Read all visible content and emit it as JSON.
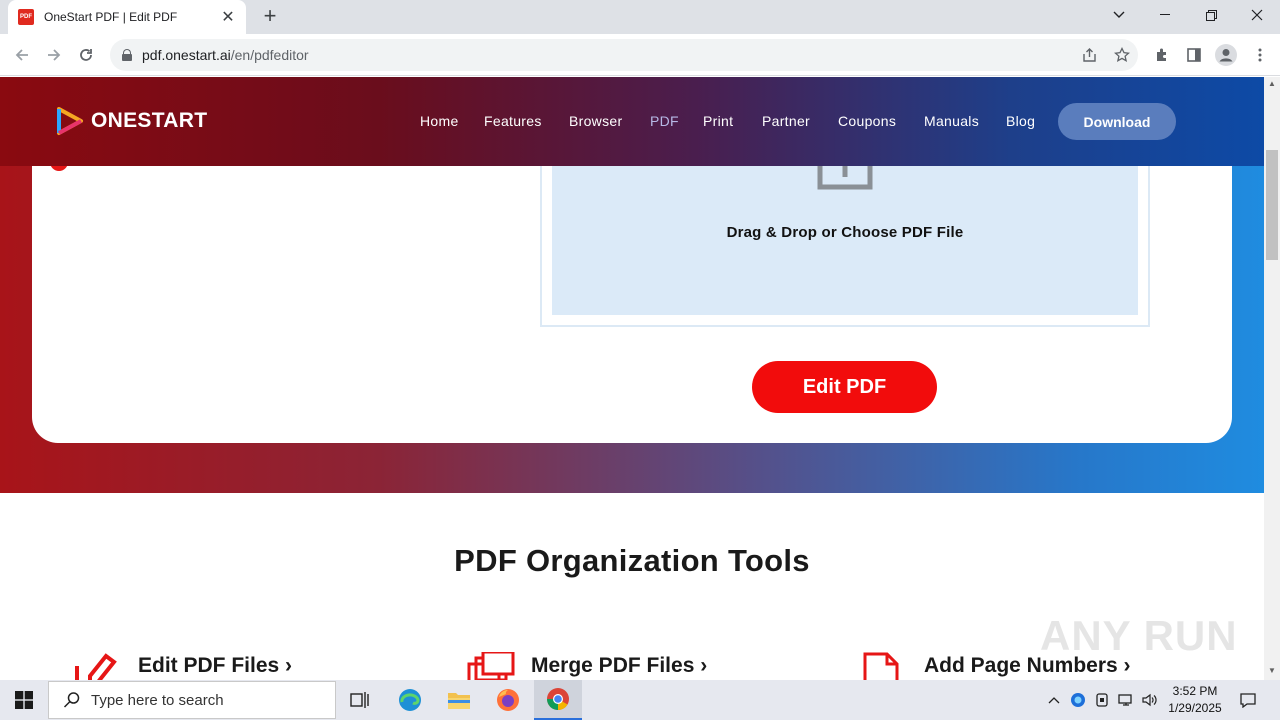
{
  "browser": {
    "tab_title": "OneStart PDF | Edit PDF",
    "favicon_text": "PDF",
    "url_host": "pdf.onestart.ai",
    "url_path": "/en/pdfeditor"
  },
  "site": {
    "logo_text": "ONESTART",
    "nav": [
      "Home",
      "Features",
      "Browser",
      "PDF",
      "Print",
      "Partner",
      "Coupons",
      "Manuals",
      "Blog"
    ],
    "active_nav": "PDF",
    "download_label": "Download"
  },
  "editor": {
    "drop_text": "Drag & Drop or Choose PDF File",
    "edit_button": "Edit PDF"
  },
  "tools_section": {
    "title": "PDF Organization Tools",
    "tools": [
      {
        "label": "Edit PDF Files ›",
        "icon": "edit-pdf-icon"
      },
      {
        "label": "Merge PDF Files ›",
        "icon": "merge-pdf-icon"
      },
      {
        "label": "Add Page Numbers ›",
        "icon": "page-numbers-icon"
      }
    ]
  },
  "watermark": "ANY RUN",
  "taskbar": {
    "search_placeholder": "Type here to search",
    "time": "3:52 PM",
    "date": "1/29/2025"
  },
  "colors": {
    "accent_red": "#f20c0c",
    "dropzone_bg": "#dbeaf8",
    "download_btn": "#5a7dbd"
  }
}
